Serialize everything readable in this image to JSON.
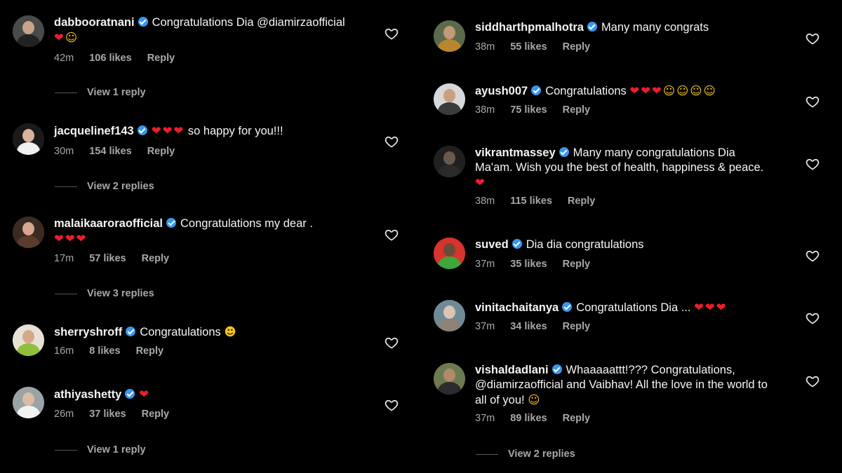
{
  "left_comments": [
    {
      "username": "dabbooratnani",
      "text": "Congratulations Dia @diamirzaofficial",
      "emojis": [
        {
          "char": "❤",
          "kind": "heart"
        },
        {
          "char": "☺",
          "kind": "hug"
        }
      ],
      "time": "42m",
      "likes": "106 likes",
      "reply": "Reply",
      "view_replies": "View 1 reply",
      "avatar_colors": [
        "#4a4a4a",
        "#c9a48a",
        "#222222"
      ]
    },
    {
      "username": "jacquelinef143",
      "text": "",
      "emojis": [
        {
          "char": "❤",
          "kind": "heart"
        },
        {
          "char": "❤",
          "kind": "heart"
        },
        {
          "char": "❤",
          "kind": "heart"
        }
      ],
      "text_after": "so happy for you!!!",
      "time": "30m",
      "likes": "154 likes",
      "reply": "Reply",
      "view_replies": "View 2 replies",
      "avatar_colors": [
        "#1a1a1a",
        "#d9b39a",
        "#f0f0f0"
      ]
    },
    {
      "username": "malaikaaroraofficial",
      "text": "Congratulations my dear .",
      "emojis": [
        {
          "char": "❤",
          "kind": "heart"
        },
        {
          "char": "❤",
          "kind": "heart"
        },
        {
          "char": "❤",
          "kind": "heart"
        }
      ],
      "time": "17m",
      "likes": "57 likes",
      "reply": "Reply",
      "view_replies": "View 3 replies",
      "avatar_colors": [
        "#3a2a22",
        "#d7a68c",
        "#5a3b2c"
      ]
    },
    {
      "username": "sherryshroff",
      "text": "Congratulations",
      "emojis": [
        {
          "char": "☻",
          "kind": "hug"
        }
      ],
      "time": "16m",
      "likes": "8 likes",
      "reply": "Reply",
      "view_replies": "",
      "avatar_colors": [
        "#e8e2d6",
        "#d4a98a",
        "#8fbf3c"
      ]
    },
    {
      "username": "athiyashetty",
      "text": "",
      "emojis": [
        {
          "char": "❤",
          "kind": "heart"
        }
      ],
      "time": "26m",
      "likes": "37 likes",
      "reply": "Reply",
      "view_replies": "View 1 reply",
      "avatar_colors": [
        "#9aa3a6",
        "#dcbca5",
        "#f2f2f2"
      ]
    }
  ],
  "right_comments": [
    {
      "username": "siddharthpmalhotra",
      "text": "Many many congrats",
      "emojis": [],
      "time": "38m",
      "likes": "55 likes",
      "reply": "Reply",
      "view_replies": "",
      "avatar_colors": [
        "#5a6a4a",
        "#c29a78",
        "#b8862c"
      ]
    },
    {
      "username": "ayush007",
      "text": "Congratulations",
      "emojis": [
        {
          "char": "❤",
          "kind": "heart"
        },
        {
          "char": "❤",
          "kind": "heart"
        },
        {
          "char": "❤",
          "kind": "heart"
        },
        {
          "char": "☺",
          "kind": "hug"
        },
        {
          "char": "☺",
          "kind": "hug"
        },
        {
          "char": "☺",
          "kind": "hug"
        },
        {
          "char": "☺",
          "kind": "hug"
        }
      ],
      "time": "38m",
      "likes": "75 likes",
      "reply": "Reply",
      "view_replies": "",
      "avatar_colors": [
        "#d8d8d8",
        "#c99f83",
        "#3b3b3b"
      ]
    },
    {
      "username": "vikrantmassey",
      "text": "Many many congratulations Dia Ma'am. Wish you the best of health, happiness & peace.",
      "emojis": [
        {
          "char": "❤",
          "kind": "heart"
        }
      ],
      "time": "38m",
      "likes": "115 likes",
      "reply": "Reply",
      "view_replies": "",
      "avatar_colors": [
        "#202020",
        "#6a5a4e",
        "#2a2a2a"
      ]
    },
    {
      "username": "suved",
      "text": "Dia dia congratulations",
      "emojis": [],
      "time": "37m",
      "likes": "35 likes",
      "reply": "Reply",
      "view_replies": "",
      "avatar_colors": [
        "#d8332c",
        "#6b4a3a",
        "#3ea63a"
      ]
    },
    {
      "username": "vinitachaitanya",
      "text": "Congratulations Dia ...",
      "emojis": [
        {
          "char": "❤",
          "kind": "heart"
        },
        {
          "char": "❤",
          "kind": "heart"
        },
        {
          "char": "❤",
          "kind": "heart"
        }
      ],
      "time": "37m",
      "likes": "34 likes",
      "reply": "Reply",
      "view_replies": "",
      "avatar_colors": [
        "#6e8a96",
        "#d9c5b4",
        "#8d8275"
      ]
    },
    {
      "username": "vishaldadlani",
      "text": "Whaaaaattt!??? Congratulations, @diamirzaofficial and Vaibhav! All the love in the world to all of you!",
      "emojis": [
        {
          "char": "☺",
          "kind": "hug"
        }
      ],
      "time": "37m",
      "likes": "89 likes",
      "reply": "Reply",
      "view_replies": "View 2 replies",
      "avatar_colors": [
        "#6d7a50",
        "#b08a6a",
        "#2c2c2c"
      ]
    }
  ]
}
